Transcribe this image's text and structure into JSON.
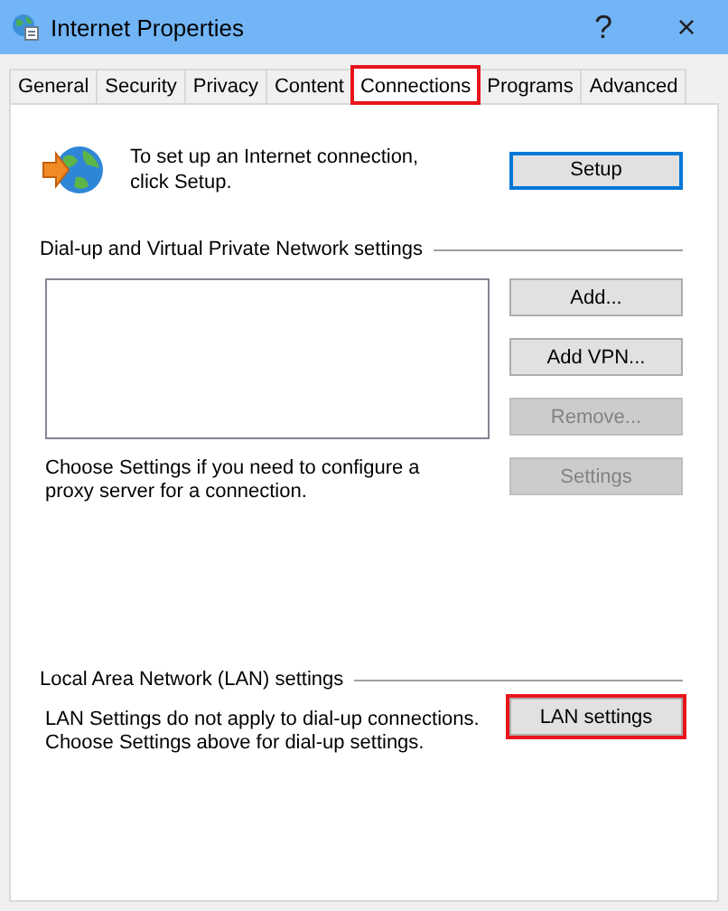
{
  "window": {
    "title": "Internet Properties",
    "help_button": "?",
    "close_button": "×"
  },
  "tabs": [
    {
      "label": "General",
      "selected": false,
      "highlighted": false
    },
    {
      "label": "Security",
      "selected": false,
      "highlighted": false
    },
    {
      "label": "Privacy",
      "selected": false,
      "highlighted": false
    },
    {
      "label": "Content",
      "selected": false,
      "highlighted": false
    },
    {
      "label": "Connections",
      "selected": true,
      "highlighted": true
    },
    {
      "label": "Programs",
      "selected": false,
      "highlighted": false
    },
    {
      "label": "Advanced",
      "selected": false,
      "highlighted": false
    }
  ],
  "setup": {
    "text": "To set up an Internet connection, click Setup.",
    "button": {
      "label": "Setup",
      "focused": true,
      "disabled": false,
      "highlighted": false
    }
  },
  "dialup": {
    "heading": "Dial-up and Virtual Private Network settings",
    "buttons": [
      {
        "label": "Add...",
        "focused": false,
        "disabled": false,
        "highlighted": false
      },
      {
        "label": "Add VPN...",
        "focused": false,
        "disabled": false,
        "highlighted": false
      },
      {
        "label": "Remove...",
        "focused": false,
        "disabled": true,
        "highlighted": false
      }
    ],
    "proxy_text": "Choose Settings if you need to configure a proxy server for a connection.",
    "settings_button": {
      "label": "Settings",
      "focused": false,
      "disabled": true,
      "highlighted": false
    }
  },
  "lan": {
    "heading": "Local Area Network (LAN) settings",
    "text": "LAN Settings do not apply to dial-up connections. Choose Settings above for dial-up settings.",
    "button": {
      "label": "LAN settings",
      "focused": false,
      "disabled": false,
      "highlighted": true
    }
  }
}
